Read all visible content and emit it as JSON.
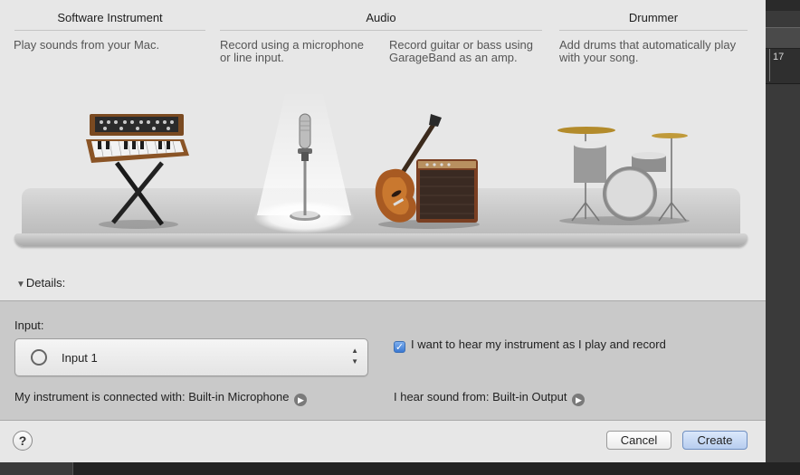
{
  "columns": {
    "software": {
      "title": "Software Instrument",
      "desc": "Play sounds from your Mac."
    },
    "audio": {
      "title": "Audio",
      "mic_desc_line1": "Record using a microphone",
      "mic_desc_line2": "or line input.",
      "guitar_desc_line1": "Record guitar or bass using",
      "guitar_desc_line2": "GarageBand as an amp."
    },
    "drummer": {
      "title": "Drummer",
      "desc_line1": "Add drums that automatically play",
      "desc_line2": "with your song."
    }
  },
  "details": {
    "label": "Details:",
    "input_label": "Input:",
    "input_value": "Input 1",
    "monitor_label": "I want to hear my instrument as I play and record",
    "monitor_checked": true,
    "connected_label": "My instrument is connected with: Built-in Microphone",
    "output_label": "I hear sound from: Built-in Output"
  },
  "footer": {
    "help": "?",
    "cancel": "Cancel",
    "create": "Create"
  },
  "background": {
    "ruler_number": "17"
  },
  "colors": {
    "dialog_bg": "#e7e7e7",
    "panel_bg": "#c9c9c9",
    "accent": "#3a78d2"
  }
}
